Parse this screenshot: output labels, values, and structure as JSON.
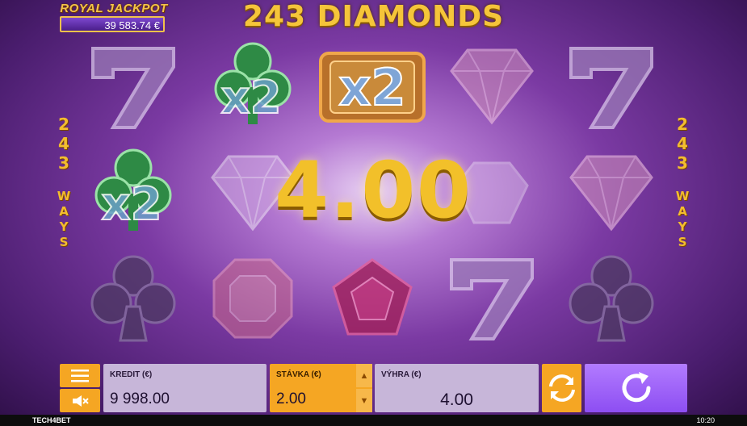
{
  "jackpot": {
    "title": "ROYAL JACKPOT",
    "amount": "39 583.74 €"
  },
  "game": {
    "title": "243 DIAMONDS"
  },
  "ways": {
    "number": [
      "2",
      "4",
      "3"
    ],
    "word": [
      "W",
      "A",
      "Y",
      "S"
    ]
  },
  "reels": [
    [
      "seven",
      "clover-x2",
      "club"
    ],
    [
      "clover-x2",
      "diamond",
      "octagon-gem"
    ],
    [
      "gold-x2",
      "win-overlay",
      "pentagon-gem"
    ],
    [
      "diamond",
      "gem-oval",
      "seven"
    ],
    [
      "seven",
      "diamond",
      "club"
    ]
  ],
  "win": {
    "big_amount": "4.00"
  },
  "controls": {
    "credit_label": "KREDIT (€)",
    "credit_value": "9 998.00",
    "bet_label": "STÁVKA (€)",
    "bet_value": "2.00",
    "win_label": "VÝHRA (€)",
    "win_value": "4.00"
  },
  "icons": {
    "menu": "menu-icon",
    "sound": "sound-muted-icon",
    "auto": "autoplay-icon",
    "spin": "spin-icon",
    "up": "arrow-up-icon",
    "down": "arrow-down-icon"
  },
  "colors": {
    "accent": "#f5a623",
    "spin": "#9c62f8",
    "panel": "#c7b6d9",
    "gold": "#f2c02a"
  },
  "footer": {
    "brand": "TECH4BET",
    "time": "10:20"
  }
}
